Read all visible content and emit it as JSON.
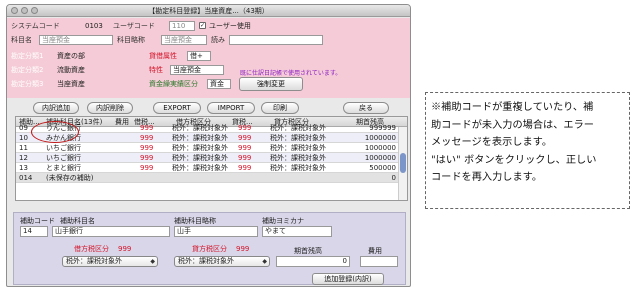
{
  "window": {
    "title": "【勘定科目登録】当座資産...（43期）"
  },
  "header": {
    "system_code_label": "システムコード",
    "system_code": "0103",
    "user_code_label": "ユーザコード",
    "user_code": "110",
    "user_use_label": "ユーザー使用",
    "account_name_label": "科目名",
    "account_name": "当座預金",
    "account_short_label": "科目略称",
    "account_short": "当座預金",
    "reading_label": "読み",
    "reading": "",
    "class1_label": "勘定分類1",
    "class1": "資産の部",
    "class2_label": "勘定分類2",
    "class2": "流動資産",
    "class3_label": "勘定分類3",
    "class3": "当座資産",
    "debit_attr_label": "貸借属性",
    "debit_attr": "借+",
    "trait_label": "特性",
    "trait": "当座預金",
    "fund_label": "資金繰実績区分",
    "fund": "資金",
    "note": "既に仕訳日記帳で使用されています。",
    "force_change": "強制変更"
  },
  "toolbar": {
    "add": "内訳追加",
    "delete": "内訳削除",
    "export": "EXPORT",
    "import": "IMPORT",
    "print": "印刷",
    "back": "戻る"
  },
  "table": {
    "headers": [
      "補助...",
      "補助科目名(13件)",
      "費用",
      "借税...",
      "借方税区分",
      "貸税...",
      "貸方税区分",
      "期首残高"
    ],
    "rows": [
      {
        "code": "09",
        "name": "りんご銀行",
        "cost": "",
        "dtax": "999",
        "dcat": "税外：課税対象外",
        "ctax": "999",
        "ccat": "税外：課税対象外",
        "bal": "999999",
        "style": "cut"
      },
      {
        "code": "10",
        "name": "みかん銀行",
        "cost": "",
        "dtax": "999",
        "dcat": "税外：課税対象外",
        "ctax": "999",
        "ccat": "税外：課税対象外",
        "bal": "1000000",
        "style": "alt"
      },
      {
        "code": "11",
        "name": "いちご銀行",
        "cost": "",
        "dtax": "999",
        "dcat": "税外：課税対象外",
        "ctax": "999",
        "ccat": "税外：課税対象外",
        "bal": "1000000",
        "style": ""
      },
      {
        "code": "12",
        "name": "いちご銀行",
        "cost": "",
        "dtax": "999",
        "dcat": "税外：課税対象外",
        "ctax": "999",
        "ccat": "税外：課税対象外",
        "bal": "1000000",
        "style": "alt"
      },
      {
        "code": "13",
        "name": "とまと銀行",
        "cost": "",
        "dtax": "999",
        "dcat": "税外：課税対象外",
        "ctax": "999",
        "ccat": "税外：課税対象外",
        "bal": "500000",
        "style": ""
      },
      {
        "code": "014",
        "name": "(未保存の補助)",
        "cost": "",
        "dtax": "",
        "dcat": "",
        "ctax": "",
        "ccat": "",
        "bal": "0",
        "style": "unsaved"
      }
    ]
  },
  "editor": {
    "code_label": "補助コード",
    "code": "14",
    "name_label": "補助科目名",
    "name": "山手銀行",
    "short_label": "補助科目略称",
    "short": "山手",
    "kana_label": "補助ヨミカナ",
    "kana": "やまて",
    "dtax_label": "借方税区分",
    "dtax_code": "999",
    "ctax_label": "貸方税区分",
    "ctax_code": "999",
    "balance_label": "期首残高",
    "balance": "0",
    "cost_label": "費用",
    "dtax_select": "税外：課税対象外",
    "ctax_select": "税外：課税対象外",
    "add_button": "追加登録(内訳)"
  },
  "callout": {
    "line1": "※補助コードが重複していたり、補",
    "line2": "助コードが未入力の場合は、エラー",
    "line3": "メッセージを表示します。",
    "line4": "\"はい\" ボタンをクリックし、正しい",
    "line5": "コードを再入力します。"
  },
  "colors": {
    "header_bg": "#f4cbd6",
    "editor_bg": "#d8d6e8",
    "accent_red": "#d4142a"
  }
}
